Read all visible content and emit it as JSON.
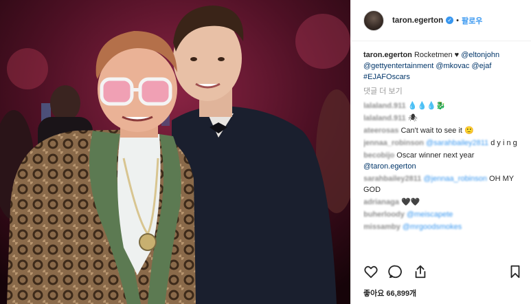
{
  "colors": {
    "link": "#003569",
    "follow": "#3897f0",
    "muted": "#999999",
    "text": "#262626"
  },
  "header": {
    "username": "taron.egerton",
    "verified_icon": "verified-badge-icon",
    "separator": "•",
    "follow_label": "팔로우"
  },
  "caption": {
    "username": "taron.egerton",
    "text": "Rocketmen",
    "heart": "♥",
    "tags": [
      "@eltonjohn",
      "@gettyentertainment",
      "@mkovac",
      "@ejaf",
      "#EJAFOscars"
    ]
  },
  "more_comments_label": "댓글 더 보기",
  "comments": [
    {
      "user": "lalaland.911",
      "text": "💧💧💧🐉"
    },
    {
      "user": "lalaland.911",
      "text": "🕷"
    },
    {
      "user": "ateerosas",
      "text": "Can't wait to see it 🙂"
    },
    {
      "user": "jennaa_robinson",
      "mention": "@sarahbailey2811",
      "text": "d y i n g"
    },
    {
      "user": "becobijo",
      "text": "Oscar winner next year",
      "link": "@taron.egerton"
    },
    {
      "user": "sarahbailey2811",
      "mention": "@jennaa_robinson",
      "text": "OH MY GOD"
    },
    {
      "user": "adrianaga",
      "text": "🖤🖤"
    },
    {
      "user": "buherloody",
      "mention": "@meiscapete",
      "text": ""
    },
    {
      "user": "missamby",
      "mention": "@mrgoodsmokes",
      "text": ""
    }
  ],
  "actions": {
    "like": "heart-icon",
    "comment": "comment-icon",
    "share": "share-icon",
    "save": "bookmark-icon"
  },
  "likes": {
    "label": "좋아요 66,899개"
  }
}
